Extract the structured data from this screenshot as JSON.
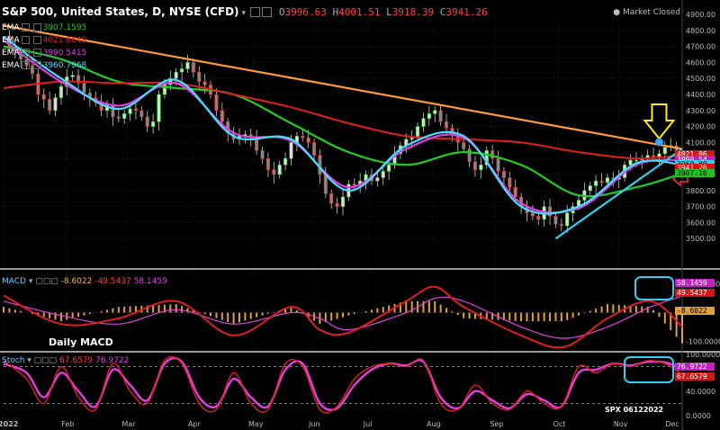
{
  "header": {
    "symbol": "S&P 500, United States, D, NYSE (CFD)",
    "ohlc": [
      {
        "k": "O",
        "v": "3996.63"
      },
      {
        "k": "H",
        "v": "4001.51"
      },
      {
        "k": "L",
        "v": "3918.39"
      },
      {
        "k": "C",
        "v": "3941.26"
      }
    ],
    "market_status": "Market Closed"
  },
  "emas": [
    {
      "label": "EMA",
      "value": "3907.1595",
      "color": "#22cc22"
    },
    {
      "label": "EMA",
      "value": "4021.0649",
      "color": "#e02020"
    },
    {
      "label": "EMA",
      "value": "3990.5415",
      "color": "#e040e0"
    },
    {
      "label": "EMA",
      "value": "3960.7968",
      "color": "#40e0ff"
    }
  ],
  "price_labels": [
    {
      "text": "4021.06",
      "bg": "#d01818",
      "fg": "#ffffff",
      "value": 4021.06
    },
    {
      "text": "3990.54",
      "bg": "#c020c0",
      "fg": "#ffffff",
      "value": 3990.54
    },
    {
      "text": "3960.80",
      "bg": "#30d0f0",
      "fg": "#000000",
      "value": 3960.8
    },
    {
      "text": "3941.26",
      "bg": "#e01010",
      "fg": "#ffffff",
      "value": 3941.26
    },
    {
      "text": "3907.16",
      "bg": "#20c020",
      "fg": "#000000",
      "value": 3907.16
    }
  ],
  "macd": {
    "label": "MACD",
    "values": [
      {
        "text": "-8.6022",
        "color": "#ffb040"
      },
      {
        "text": "-49.5437",
        "color": "#ff4040"
      },
      {
        "text": "58.1459",
        "color": "#e040e0"
      }
    ],
    "axis_labels": [
      {
        "text": "58.1459",
        "bg": "#c020c0",
        "fg": "#ffffff"
      },
      {
        "text": "49.5437",
        "bg": "#d01818",
        "fg": "#ffffff"
      },
      {
        "text": "-8.6022",
        "bg": "#e0a040",
        "fg": "#000000"
      }
    ],
    "caption": "Daily MACD"
  },
  "stoch": {
    "label": "Stoch",
    "values": [
      {
        "text": "67.6579",
        "color": "#ff4040"
      },
      {
        "text": "76.9722",
        "color": "#e040e0"
      }
    ],
    "axis_labels": [
      {
        "text": "76.9722",
        "bg": "#c020c0",
        "fg": "#ffffff"
      },
      {
        "text": "67.6579",
        "bg": "#d01818",
        "fg": "#ffffff"
      }
    ],
    "watermark": "SPX 06122022"
  },
  "chart_data": {
    "type": "line",
    "title": "S&P 500, United States, D, NYSE (CFD)",
    "x_labels": [
      "2022",
      "Feb",
      "Mar",
      "Apr",
      "May",
      "Jun",
      "Jul",
      "Aug",
      "Sep",
      "Oct",
      "Nov",
      "Dec"
    ],
    "x_positions": [
      0,
      22,
      43,
      66,
      87,
      108,
      127,
      149,
      171,
      193,
      214,
      232
    ],
    "price_axis": {
      "min": 3400,
      "max": 4900,
      "ticks": [
        4900,
        4800,
        4700,
        4600,
        4500,
        4400,
        4300,
        4200,
        4100,
        4000,
        3900,
        3800,
        3700,
        3600,
        3500
      ]
    },
    "macd_axis": {
      "ticks": [
        {
          "text": "100.0000",
          "value": 100
        },
        {
          "text": "-100.0000",
          "value": -100
        }
      ]
    },
    "stoch_axis": {
      "ticks": [
        {
          "text": "100.0000",
          "value": 100
        },
        {
          "text": "40.0000",
          "value": 40
        },
        {
          "text": "0.0000",
          "value": 0
        }
      ]
    },
    "close_series": [
      [
        0,
        4766
      ],
      [
        2,
        4700
      ],
      [
        4,
        4670
      ],
      [
        6,
        4620
      ],
      [
        8,
        4580
      ],
      [
        10,
        4530
      ],
      [
        12,
        4400
      ],
      [
        14,
        4370
      ],
      [
        16,
        4300
      ],
      [
        18,
        4380
      ],
      [
        20,
        4450
      ],
      [
        22,
        4510
      ],
      [
        24,
        4520
      ],
      [
        26,
        4470
      ],
      [
        28,
        4410
      ],
      [
        30,
        4380
      ],
      [
        32,
        4350
      ],
      [
        34,
        4300
      ],
      [
        36,
        4340
      ],
      [
        38,
        4260
      ],
      [
        40,
        4250
      ],
      [
        42,
        4280
      ],
      [
        44,
        4310
      ],
      [
        46,
        4300
      ],
      [
        48,
        4260
      ],
      [
        50,
        4200
      ],
      [
        52,
        4230
      ],
      [
        54,
        4400
      ],
      [
        56,
        4460
      ],
      [
        58,
        4500
      ],
      [
        60,
        4540
      ],
      [
        62,
        4560
      ],
      [
        64,
        4600
      ],
      [
        66,
        4540
      ],
      [
        68,
        4480
      ],
      [
        70,
        4460
      ],
      [
        72,
        4400
      ],
      [
        74,
        4300
      ],
      [
        76,
        4230
      ],
      [
        78,
        4160
      ],
      [
        80,
        4120
      ],
      [
        82,
        4140
      ],
      [
        84,
        4150
      ],
      [
        86,
        4130
      ],
      [
        88,
        4050
      ],
      [
        90,
        4000
      ],
      [
        92,
        3930
      ],
      [
        94,
        3900
      ],
      [
        96,
        3960
      ],
      [
        98,
        4000
      ],
      [
        100,
        4100
      ],
      [
        102,
        4140
      ],
      [
        104,
        4130
      ],
      [
        106,
        4100
      ],
      [
        108,
        4020
      ],
      [
        110,
        3900
      ],
      [
        112,
        3780
      ],
      [
        114,
        3720
      ],
      [
        116,
        3700
      ],
      [
        118,
        3760
      ],
      [
        120,
        3840
      ],
      [
        122,
        3830
      ],
      [
        124,
        3860
      ],
      [
        126,
        3900
      ],
      [
        128,
        3860
      ],
      [
        130,
        3880
      ],
      [
        132,
        3920
      ],
      [
        134,
        3960
      ],
      [
        136,
        4030
      ],
      [
        138,
        4080
      ],
      [
        140,
        4120
      ],
      [
        142,
        4130
      ],
      [
        144,
        4200
      ],
      [
        146,
        4250
      ],
      [
        148,
        4280
      ],
      [
        150,
        4300
      ],
      [
        152,
        4230
      ],
      [
        154,
        4190
      ],
      [
        156,
        4150
      ],
      [
        158,
        4100
      ],
      [
        160,
        4060
      ],
      [
        162,
        3980
      ],
      [
        164,
        3930
      ],
      [
        166,
        3960
      ],
      [
        168,
        4050
      ],
      [
        170,
        4000
      ],
      [
        172,
        3920
      ],
      [
        174,
        3880
      ],
      [
        176,
        3820
      ],
      [
        178,
        3760
      ],
      [
        180,
        3700
      ],
      [
        182,
        3660
      ],
      [
        184,
        3640
      ],
      [
        186,
        3620
      ],
      [
        188,
        3700
      ],
      [
        190,
        3640
      ],
      [
        192,
        3590
      ],
      [
        194,
        3580
      ],
      [
        196,
        3660
      ],
      [
        198,
        3700
      ],
      [
        200,
        3740
      ],
      [
        202,
        3800
      ],
      [
        204,
        3830
      ],
      [
        206,
        3860
      ],
      [
        208,
        3850
      ],
      [
        210,
        3880
      ],
      [
        212,
        3870
      ],
      [
        214,
        3880
      ],
      [
        216,
        3960
      ],
      [
        218,
        3990
      ],
      [
        220,
        3990
      ],
      [
        222,
        4000
      ],
      [
        224,
        4020
      ],
      [
        226,
        4010
      ],
      [
        228,
        4030
      ],
      [
        230,
        4070
      ],
      [
        232,
        4080
      ],
      [
        234,
        3990
      ],
      [
        236,
        3941
      ]
    ],
    "ema_series": [
      {
        "name": "EMA 3907.1595",
        "color": "#22cc22",
        "values": [
          [
            0,
            4700
          ],
          [
            20,
            4620
          ],
          [
            40,
            4480
          ],
          [
            60,
            4440
          ],
          [
            80,
            4400
          ],
          [
            100,
            4220
          ],
          [
            120,
            4040
          ],
          [
            140,
            3960
          ],
          [
            160,
            4040
          ],
          [
            180,
            3960
          ],
          [
            200,
            3770
          ],
          [
            220,
            3820
          ],
          [
            236,
            3907
          ]
        ]
      },
      {
        "name": "EMA 4021.0649",
        "color": "#e02020",
        "values": [
          [
            0,
            4440
          ],
          [
            20,
            4480
          ],
          [
            40,
            4470
          ],
          [
            60,
            4470
          ],
          [
            80,
            4400
          ],
          [
            100,
            4320
          ],
          [
            120,
            4220
          ],
          [
            140,
            4140
          ],
          [
            160,
            4120
          ],
          [
            180,
            4100
          ],
          [
            200,
            4040
          ],
          [
            220,
            4000
          ],
          [
            236,
            4021
          ]
        ]
      },
      {
        "name": "EMA 3990.5415",
        "color": "#e040e0",
        "values": [
          [
            0,
            4740
          ],
          [
            20,
            4480
          ],
          [
            40,
            4330
          ],
          [
            60,
            4470
          ],
          [
            80,
            4160
          ],
          [
            100,
            4110
          ],
          [
            120,
            3820
          ],
          [
            140,
            4060
          ],
          [
            160,
            4130
          ],
          [
            180,
            3720
          ],
          [
            200,
            3690
          ],
          [
            220,
            3960
          ],
          [
            236,
            3990
          ]
        ]
      },
      {
        "name": "EMA 3960.7968",
        "color": "#40e0ff",
        "values": [
          [
            0,
            4760
          ],
          [
            20,
            4500
          ],
          [
            40,
            4310
          ],
          [
            60,
            4490
          ],
          [
            80,
            4140
          ],
          [
            100,
            4120
          ],
          [
            120,
            3800
          ],
          [
            140,
            4080
          ],
          [
            160,
            4140
          ],
          [
            180,
            3700
          ],
          [
            200,
            3700
          ],
          [
            220,
            3970
          ],
          [
            236,
            3960
          ]
        ]
      }
    ],
    "trendlines": [
      {
        "name": "resistance",
        "color": "#ff9a3a",
        "from": [
          0,
          4830
        ],
        "to": [
          236,
          4060
        ]
      },
      {
        "name": "support",
        "color": "#30d0f0",
        "from": [
          192,
          3500
        ],
        "to": [
          236,
          4060
        ]
      }
    ],
    "macd_series": {
      "macd": [
        [
          0,
          60
        ],
        [
          20,
          -40
        ],
        [
          40,
          -20
        ],
        [
          60,
          40
        ],
        [
          80,
          -80
        ],
        [
          100,
          20
        ],
        [
          110,
          -60
        ],
        [
          120,
          -70
        ],
        [
          140,
          40
        ],
        [
          150,
          90
        ],
        [
          160,
          20
        ],
        [
          180,
          -80
        ],
        [
          195,
          -120
        ],
        [
          210,
          -20
        ],
        [
          225,
          40
        ],
        [
          236,
          -49.5
        ]
      ],
      "signal": [
        [
          0,
          40
        ],
        [
          20,
          -10
        ],
        [
          40,
          -40
        ],
        [
          60,
          10
        ],
        [
          80,
          -40
        ],
        [
          100,
          0
        ],
        [
          110,
          -20
        ],
        [
          120,
          -60
        ],
        [
          140,
          0
        ],
        [
          150,
          50
        ],
        [
          160,
          40
        ],
        [
          180,
          -50
        ],
        [
          195,
          -90
        ],
        [
          210,
          -50
        ],
        [
          225,
          20
        ],
        [
          236,
          58.1
        ]
      ],
      "histogram": -8.6022
    },
    "stoch_series": {
      "k": [
        [
          0,
          90
        ],
        [
          8,
          60
        ],
        [
          14,
          20
        ],
        [
          20,
          80
        ],
        [
          26,
          30
        ],
        [
          32,
          10
        ],
        [
          38,
          85
        ],
        [
          44,
          40
        ],
        [
          50,
          20
        ],
        [
          56,
          90
        ],
        [
          62,
          85
        ],
        [
          68,
          20
        ],
        [
          74,
          10
        ],
        [
          80,
          70
        ],
        [
          86,
          20
        ],
        [
          92,
          10
        ],
        [
          98,
          85
        ],
        [
          104,
          80
        ],
        [
          110,
          10
        ],
        [
          116,
          15
        ],
        [
          122,
          60
        ],
        [
          128,
          80
        ],
        [
          134,
          85
        ],
        [
          140,
          80
        ],
        [
          146,
          90
        ],
        [
          152,
          20
        ],
        [
          158,
          10
        ],
        [
          164,
          50
        ],
        [
          170,
          20
        ],
        [
          176,
          10
        ],
        [
          182,
          40
        ],
        [
          188,
          20
        ],
        [
          194,
          15
        ],
        [
          200,
          80
        ],
        [
          206,
          70
        ],
        [
          212,
          85
        ],
        [
          218,
          80
        ],
        [
          224,
          90
        ],
        [
          230,
          85
        ],
        [
          236,
          67.66
        ]
      ],
      "d": [
        [
          0,
          85
        ],
        [
          8,
          70
        ],
        [
          14,
          30
        ],
        [
          20,
          70
        ],
        [
          26,
          40
        ],
        [
          32,
          15
        ],
        [
          38,
          75
        ],
        [
          44,
          50
        ],
        [
          50,
          25
        ],
        [
          56,
          85
        ],
        [
          62,
          88
        ],
        [
          68,
          30
        ],
        [
          74,
          15
        ],
        [
          80,
          60
        ],
        [
          86,
          30
        ],
        [
          92,
          15
        ],
        [
          98,
          75
        ],
        [
          104,
          85
        ],
        [
          110,
          20
        ],
        [
          116,
          12
        ],
        [
          122,
          50
        ],
        [
          128,
          75
        ],
        [
          134,
          85
        ],
        [
          140,
          82
        ],
        [
          146,
          88
        ],
        [
          152,
          30
        ],
        [
          158,
          12
        ],
        [
          164,
          40
        ],
        [
          170,
          25
        ],
        [
          176,
          12
        ],
        [
          182,
          35
        ],
        [
          188,
          25
        ],
        [
          194,
          15
        ],
        [
          200,
          70
        ],
        [
          206,
          75
        ],
        [
          212,
          85
        ],
        [
          218,
          82
        ],
        [
          224,
          88
        ],
        [
          230,
          87
        ],
        [
          236,
          76.97
        ]
      ]
    }
  }
}
